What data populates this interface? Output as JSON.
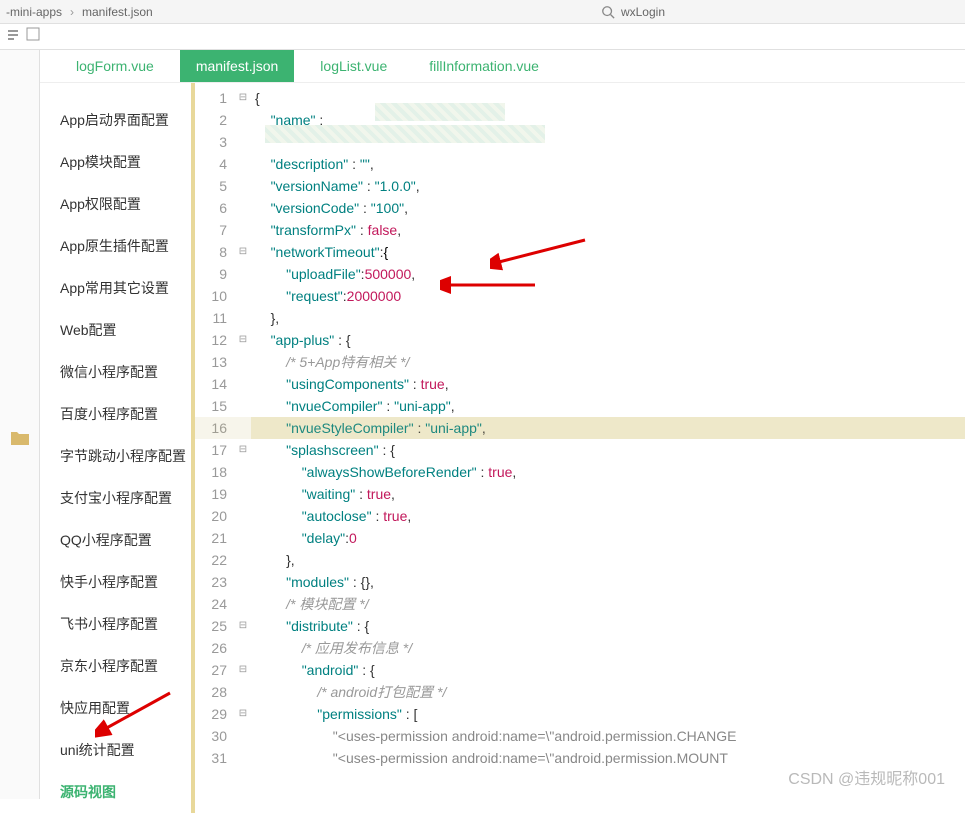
{
  "breadcrumb": {
    "item1": "-mini-apps",
    "sep": "›",
    "item2": "manifest.json"
  },
  "search": {
    "text": "wxLogin"
  },
  "tabs": [
    {
      "label": "logForm.vue",
      "active": false
    },
    {
      "label": "manifest.json",
      "active": true
    },
    {
      "label": "logList.vue",
      "active": false
    },
    {
      "label": "fillInformation.vue",
      "active": false
    }
  ],
  "sidebar": {
    "items": [
      "App启动界面配置",
      "App模块配置",
      "App权限配置",
      "App原生插件配置",
      "App常用其它设置",
      "Web配置",
      "微信小程序配置",
      "百度小程序配置",
      "字节跳动小程序配置",
      "支付宝小程序配置",
      "QQ小程序配置",
      "快手小程序配置",
      "飞书小程序配置",
      "京东小程序配置",
      "快应用配置",
      "uni统计配置",
      "源码视图"
    ],
    "activeIndex": 16
  },
  "code": {
    "lines": [
      {
        "n": 1,
        "fold": "⊟",
        "raw": "{"
      },
      {
        "n": 2,
        "fold": "",
        "key": "name",
        "after": " : "
      },
      {
        "n": 3,
        "fold": "",
        "raw": ""
      },
      {
        "n": 4,
        "fold": "",
        "key": "description",
        "str": "",
        "comma": true
      },
      {
        "n": 5,
        "fold": "",
        "key": "versionName",
        "str": "1.0.0",
        "comma": true
      },
      {
        "n": 6,
        "fold": "",
        "key": "versionCode",
        "str": "100",
        "comma": true
      },
      {
        "n": 7,
        "fold": "",
        "key": "transformPx",
        "bool": "false",
        "comma": true
      },
      {
        "n": 8,
        "fold": "⊟",
        "key": "networkTimeout",
        "open": "{"
      },
      {
        "n": 9,
        "fold": "",
        "indent": 2,
        "key": "uploadFile",
        "num": "500000",
        "comma": true
      },
      {
        "n": 10,
        "fold": "",
        "indent": 2,
        "key": "request",
        "num": "2000000"
      },
      {
        "n": 11,
        "fold": "",
        "close": "},"
      },
      {
        "n": 12,
        "fold": "⊟",
        "key": "app-plus",
        "open2": " : {"
      },
      {
        "n": 13,
        "fold": "",
        "indent": 2,
        "comment": "/* 5+App特有相关 */"
      },
      {
        "n": 14,
        "fold": "",
        "indent": 2,
        "key": "usingComponents",
        "bool": "true",
        "comma": true
      },
      {
        "n": 15,
        "fold": "",
        "indent": 2,
        "key": "nvueCompiler",
        "str": "uni-app",
        "comma": true
      },
      {
        "n": 16,
        "fold": "",
        "indent": 2,
        "key": "nvueStyleCompiler",
        "str": "uni-app",
        "comma": true,
        "hl": true
      },
      {
        "n": 17,
        "fold": "⊟",
        "indent": 2,
        "key": "splashscreen",
        "open2": " : {"
      },
      {
        "n": 18,
        "fold": "",
        "indent": 3,
        "key": "alwaysShowBeforeRender",
        "bool": "true",
        "comma": true
      },
      {
        "n": 19,
        "fold": "",
        "indent": 3,
        "key": "waiting",
        "bool": "true",
        "comma": true
      },
      {
        "n": 20,
        "fold": "",
        "indent": 3,
        "key": "autoclose",
        "bool": "true",
        "comma": true
      },
      {
        "n": 21,
        "fold": "",
        "indent": 3,
        "key": "delay",
        "num": "0"
      },
      {
        "n": 22,
        "fold": "",
        "indent": 2,
        "close": "},"
      },
      {
        "n": 23,
        "fold": "",
        "indent": 2,
        "key": "modules",
        "raw2": " : {},"
      },
      {
        "n": 24,
        "fold": "",
        "indent": 2,
        "comment": "/* 模块配置 */"
      },
      {
        "n": 25,
        "fold": "⊟",
        "indent": 2,
        "key": "distribute",
        "open2": " : {"
      },
      {
        "n": 26,
        "fold": "",
        "indent": 3,
        "comment": "/* 应用发布信息 */"
      },
      {
        "n": 27,
        "fold": "⊟",
        "indent": 3,
        "key": "android",
        "open2": " : {"
      },
      {
        "n": 28,
        "fold": "",
        "indent": 4,
        "comment": "/* android打包配置 */"
      },
      {
        "n": 29,
        "fold": "⊟",
        "indent": 4,
        "key": "permissions",
        "raw2": " : ["
      },
      {
        "n": 30,
        "fold": "",
        "indent": 5,
        "perm": "\"<uses-permission android:name=\\\"android.permission.CHANGE"
      },
      {
        "n": 31,
        "fold": "",
        "indent": 5,
        "perm": "\"<uses-permission android:name=\\\"android.permission.MOUNT"
      }
    ]
  },
  "watermark": "CSDN @违规昵称001"
}
